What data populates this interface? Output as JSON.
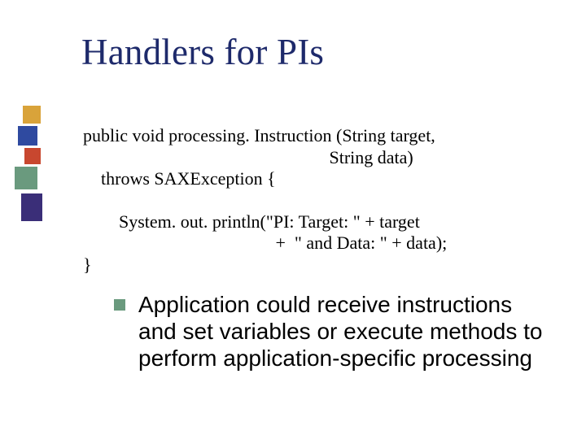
{
  "title": "Handlers for PIs",
  "code": {
    "l1": "public void processing. Instruction (String target,",
    "l2": "                                                       String data)",
    "l3": "    throws SAXException {",
    "l4": "",
    "l5": "        System. out. println(\"PI: Target: \" + target",
    "l6": "                                           +  \" and Data: \" + data);",
    "l7": "}"
  },
  "bullet": "Application could receive instructions and set variables or execute methods to perform application-specific processing",
  "sidebar_colors": [
    "#d9a33a",
    "#2f4aa0",
    "#c8472f",
    "#6a9a7e",
    "#3a2e78"
  ]
}
